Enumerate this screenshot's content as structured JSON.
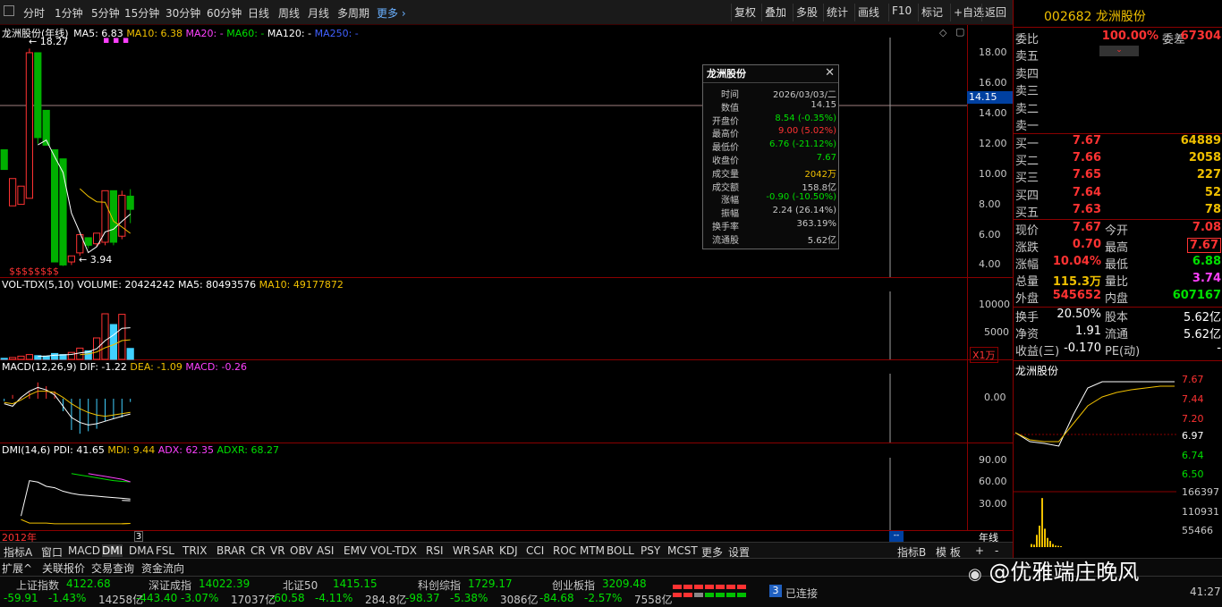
{
  "toolbar": {
    "left_items": [
      "分时",
      "1分钟",
      "5分钟",
      "15分钟",
      "30分钟",
      "60分钟",
      "日线",
      "周线",
      "月线",
      "多周期"
    ],
    "more": "更多",
    "right_buttons": [
      "复权",
      "叠加",
      "多股",
      "统计",
      "画线",
      "F10",
      "标记",
      "+自选",
      "返回"
    ]
  },
  "main_header": {
    "stock_label": "龙洲股份(年线)",
    "ma5": "MA5: 6.83",
    "ma10": "MA10: 6.38",
    "ma20": "MA20: -",
    "ma60": "MA60: -",
    "ma120": "MA120: -",
    "ma250": "MA250: -",
    "high_mark": "18.27",
    "low_mark": "3.94",
    "cursor_value": "14.15",
    "y_labels": [
      "18.00",
      "16.00",
      "14.00",
      "12.00",
      "10.00",
      "8.00",
      "6.00",
      "4.00"
    ]
  },
  "vol_header": {
    "label": "VOL-TDX(5,10)",
    "volume": "VOLUME: 20424242",
    "ma5": "MA5: 80493576",
    "ma10": "MA10: 49177872",
    "y_labels": [
      "10000",
      "5000"
    ],
    "unit": "X1万"
  },
  "macd_header": {
    "label": "MACD(12,26,9)",
    "dif": "DIF: -1.22",
    "dea": "DEA: -1.09",
    "macd": "MACD: -0.26",
    "y_labels": [
      "0.00"
    ]
  },
  "dmi_header": {
    "label": "DMI(14,6)",
    "pdi": "PDI: 41.65",
    "mdi": "MDI: 9.44",
    "adx": "ADX: 62.35",
    "adxr": "ADXR: 68.27",
    "y_labels": [
      "90.00",
      "60.00",
      "30.00"
    ]
  },
  "x_axis": {
    "start": "2012年",
    "cursor": "3",
    "end_label": "年线"
  },
  "popup": {
    "title": "龙洲股份",
    "rows": [
      {
        "label": "时间",
        "value": "2026/03/03/二",
        "color": "#c8c8c8"
      },
      {
        "label": "数值",
        "value": "14.15",
        "color": "#c8c8c8"
      },
      {
        "label": "开盘价",
        "value": "8.54 (-0.35%)",
        "color": "#00e000"
      },
      {
        "label": "最高价",
        "value": "9.00 (5.02%)",
        "color": "#ff3232"
      },
      {
        "label": "最低价",
        "value": "6.76 (-21.12%)",
        "color": "#00e000"
      },
      {
        "label": "收盘价",
        "value": "7.67",
        "color": "#00e000"
      },
      {
        "label": "成交量",
        "value": "2042万",
        "color": "#f0c000"
      },
      {
        "label": "成交额",
        "value": "158.8亿",
        "color": "#c8c8c8"
      },
      {
        "label": "涨幅",
        "value": "-0.90 (-10.50%)",
        "color": "#00e000"
      },
      {
        "label": "振幅",
        "value": "2.24 (26.14%)",
        "color": "#c8c8c8"
      },
      {
        "label": "换手率",
        "value": "363.19%",
        "color": "#c8c8c8"
      },
      {
        "label": "流通股",
        "value": "5.62亿",
        "color": "#c8c8c8"
      }
    ]
  },
  "quote": {
    "code_name": "002682 龙洲股份",
    "weibi": {
      "label": "委比",
      "value": "100.00%",
      "label2": "委差",
      "value2": "67304"
    },
    "sells": [
      {
        "label": "卖五",
        "price": "",
        "vol": ""
      },
      {
        "label": "卖四",
        "price": "",
        "vol": ""
      },
      {
        "label": "卖三",
        "price": "",
        "vol": ""
      },
      {
        "label": "卖二",
        "price": "",
        "vol": ""
      },
      {
        "label": "卖一",
        "price": "",
        "vol": ""
      }
    ],
    "buys": [
      {
        "label": "买一",
        "price": "7.67",
        "vol": "64889"
      },
      {
        "label": "买二",
        "price": "7.66",
        "vol": "2058"
      },
      {
        "label": "买三",
        "price": "7.65",
        "vol": "227"
      },
      {
        "label": "买四",
        "price": "7.64",
        "vol": "52"
      },
      {
        "label": "买五",
        "price": "7.63",
        "vol": "78"
      }
    ],
    "stats": [
      {
        "l1": "现价",
        "v1": "7.67",
        "c1": "#ff3232",
        "l2": "今开",
        "v2": "7.08",
        "c2": "#ff3232"
      },
      {
        "l1": "涨跌",
        "v1": "0.70",
        "c1": "#ff3232",
        "l2": "最高",
        "v2": "7.67",
        "c2": "#ff3232"
      },
      {
        "l1": "涨幅",
        "v1": "10.04%",
        "c1": "#ff3232",
        "l2": "最低",
        "v2": "6.88",
        "c2": "#00e000"
      },
      {
        "l1": "总量",
        "v1": "115.3万",
        "c1": "#f0c000",
        "l2": "量比",
        "v2": "3.74",
        "c2": "#ff40ff"
      },
      {
        "l1": "外盘",
        "v1": "545652",
        "c1": "#ff3232",
        "l2": "内盘",
        "v2": "607167",
        "c2": "#00e000"
      }
    ],
    "fund": [
      {
        "l1": "换手",
        "v1": "20.50%",
        "l2": "股本",
        "v2": "5.62亿"
      },
      {
        "l1": "净资",
        "v1": "1.91",
        "l2": "流通",
        "v2": "5.62亿"
      },
      {
        "l1": "收益(三)",
        "v1": "-0.170",
        "l2": "PE(动)",
        "v2": "-"
      }
    ],
    "mini_title": "龙洲股份",
    "mini_price_labels": [
      "7.67",
      "7.44",
      "7.20",
      "6.97",
      "6.74",
      "6.50"
    ],
    "mini_vol_labels": [
      "166397",
      "110931",
      "55466"
    ]
  },
  "bottom_tabs": [
    "指标A",
    "窗口",
    "MACD",
    "DMI",
    "DMA",
    "FSL",
    "TRIX",
    "BRAR",
    "CR",
    "VR",
    "OBV",
    "ASI",
    "EMV",
    "VOL-TDX",
    "RSI",
    "WR",
    "SAR",
    "KDJ",
    "CCI",
    "ROC",
    "MTM",
    "BOLL",
    "PSY",
    "MCST",
    "更多",
    "设置"
  ],
  "bottom_right_tabs": [
    "指标B",
    "模 板",
    "+",
    "-"
  ],
  "secondary_tabs": [
    "扩展^",
    "关联报价",
    "交易查询",
    "资金流向"
  ],
  "status": {
    "indices": [
      {
        "name": "上证指数",
        "value": "4122.68",
        "chg": "-59.91",
        "pct": "-1.43%",
        "amt": "14258亿"
      },
      {
        "name": "深证成指",
        "value": "14022.39",
        "chg": "-443.40",
        "pct": "-3.07%",
        "amt": "17037亿"
      },
      {
        "name": "北证50",
        "value": "1415.15",
        "chg": "-60.58",
        "pct": "-4.11%",
        "amt": "284.8亿"
      },
      {
        "name": "科创综指",
        "value": "1729.17",
        "chg": "-98.37",
        "pct": "-5.38%",
        "amt": "3086亿"
      },
      {
        "name": "创业板指",
        "value": "3209.48",
        "chg": "-84.68",
        "pct": "-2.57%",
        "amt": "7558亿"
      }
    ],
    "conn_count": "3",
    "conn_text": "已连接",
    "clock": "41:27"
  },
  "watermark": "@优雅端庄晚风",
  "chart_data": {
    "type": "candlestick",
    "x_start_label": "2012年",
    "candles": [
      {
        "open": 11.6,
        "close": 10.3,
        "high": 11.6,
        "low": 10.3
      },
      {
        "open": 7.9,
        "close": 9.7,
        "high": 9.7,
        "low": 7.9
      },
      {
        "open": 8.0,
        "close": 9.2,
        "high": 9.2,
        "low": 8.0
      },
      {
        "open": 8.4,
        "close": 18.0,
        "high": 18.27,
        "low": 8.4
      },
      {
        "open": 18.0,
        "close": 12.4,
        "high": 18.0,
        "low": 12.0
      },
      {
        "open": 14.2,
        "close": 11.9,
        "high": 14.2,
        "low": 11.9
      },
      {
        "open": 11.6,
        "close": 4.2,
        "high": 11.6,
        "low": 4.2
      },
      {
        "open": 11.0,
        "close": 4.0,
        "high": 11.0,
        "low": 3.94
      },
      {
        "open": 4.2,
        "close": 4.6,
        "high": 4.6,
        "low": 4.0
      },
      {
        "open": 4.8,
        "close": 6.0,
        "high": 6.0,
        "low": 4.6
      },
      {
        "open": 5.8,
        "close": 5.3,
        "high": 5.8,
        "low": 5.1
      },
      {
        "open": 5.4,
        "close": 6.1,
        "high": 6.1,
        "low": 5.2
      },
      {
        "open": 5.5,
        "close": 8.9,
        "high": 8.9,
        "low": 5.3
      },
      {
        "open": 8.9,
        "close": 5.5,
        "high": 8.9,
        "low": 5.3
      },
      {
        "open": 5.9,
        "close": 8.6,
        "high": 8.9,
        "low": 5.7
      },
      {
        "open": 8.54,
        "close": 7.67,
        "high": 9.0,
        "low": 6.76
      }
    ],
    "ylim": [
      3.2,
      19.0
    ],
    "volume": [
      200,
      350,
      600,
      900,
      700,
      600,
      1100,
      900,
      1300,
      2100,
      1600,
      4000,
      8500,
      6500,
      8400,
      2042
    ],
    "vol_ylim": [
      0,
      13000
    ],
    "macd": [
      -0.2,
      0.3,
      0.1,
      0.5,
      1.3,
      1.0,
      0.6,
      -1.0,
      -2.5,
      -2.8,
      -2.6,
      -2.4,
      -1.8,
      -1.6,
      -1.5,
      -0.26
    ],
    "dif": [
      -0.4,
      -0.6,
      0.1,
      0.6,
      0.9,
      0.7,
      0.3,
      -0.6,
      -1.5,
      -1.9,
      -2.1,
      -2.0,
      -1.8,
      -1.6,
      -1.4,
      -1.22
    ],
    "dea": [
      -0.3,
      -0.4,
      -0.1,
      0.3,
      0.6,
      0.6,
      0.5,
      0.1,
      -0.4,
      -0.8,
      -1.1,
      -1.3,
      -1.4,
      -1.3,
      -1.2,
      -1.09
    ],
    "macd_ylim": [
      -3.5,
      2.0
    ],
    "pdi": [
      null,
      null,
      null,
      null,
      null,
      null,
      null,
      null,
      null,
      null,
      null,
      null,
      null,
      null,
      42,
      41.65
    ],
    "mdi": [
      null,
      null,
      null,
      null,
      null,
      null,
      null,
      null,
      null,
      null,
      null,
      null,
      null,
      null,
      9,
      9.44
    ],
    "adx": [
      null,
      null,
      20,
      70,
      68,
      62,
      60,
      55,
      52,
      50,
      49,
      48,
      47,
      46,
      45,
      44
    ],
    "adxr": [
      null,
      null,
      null,
      null,
      null,
      null,
      null,
      null,
      80,
      78,
      76,
      74,
      72,
      70,
      69,
      68.27
    ],
    "dmi_ylim": [
      0,
      105
    ],
    "intraday": {
      "price": [
        7.1,
        7.0,
        6.98,
        6.95,
        7.3,
        7.6,
        7.67,
        7.67,
        7.67,
        7.67,
        7.67,
        7.67
      ],
      "avg": [
        7.1,
        7.02,
        7.0,
        7.0,
        7.2,
        7.4,
        7.5,
        7.55,
        7.58,
        7.6,
        7.62,
        7.62
      ],
      "ylim": [
        6.5,
        7.7
      ],
      "volume": [
        10000,
        8000,
        40000,
        70000,
        160000,
        60000,
        30000,
        20000,
        10000,
        5000,
        4000,
        3000
      ],
      "vol_ylim": [
        0,
        175000
      ]
    }
  }
}
